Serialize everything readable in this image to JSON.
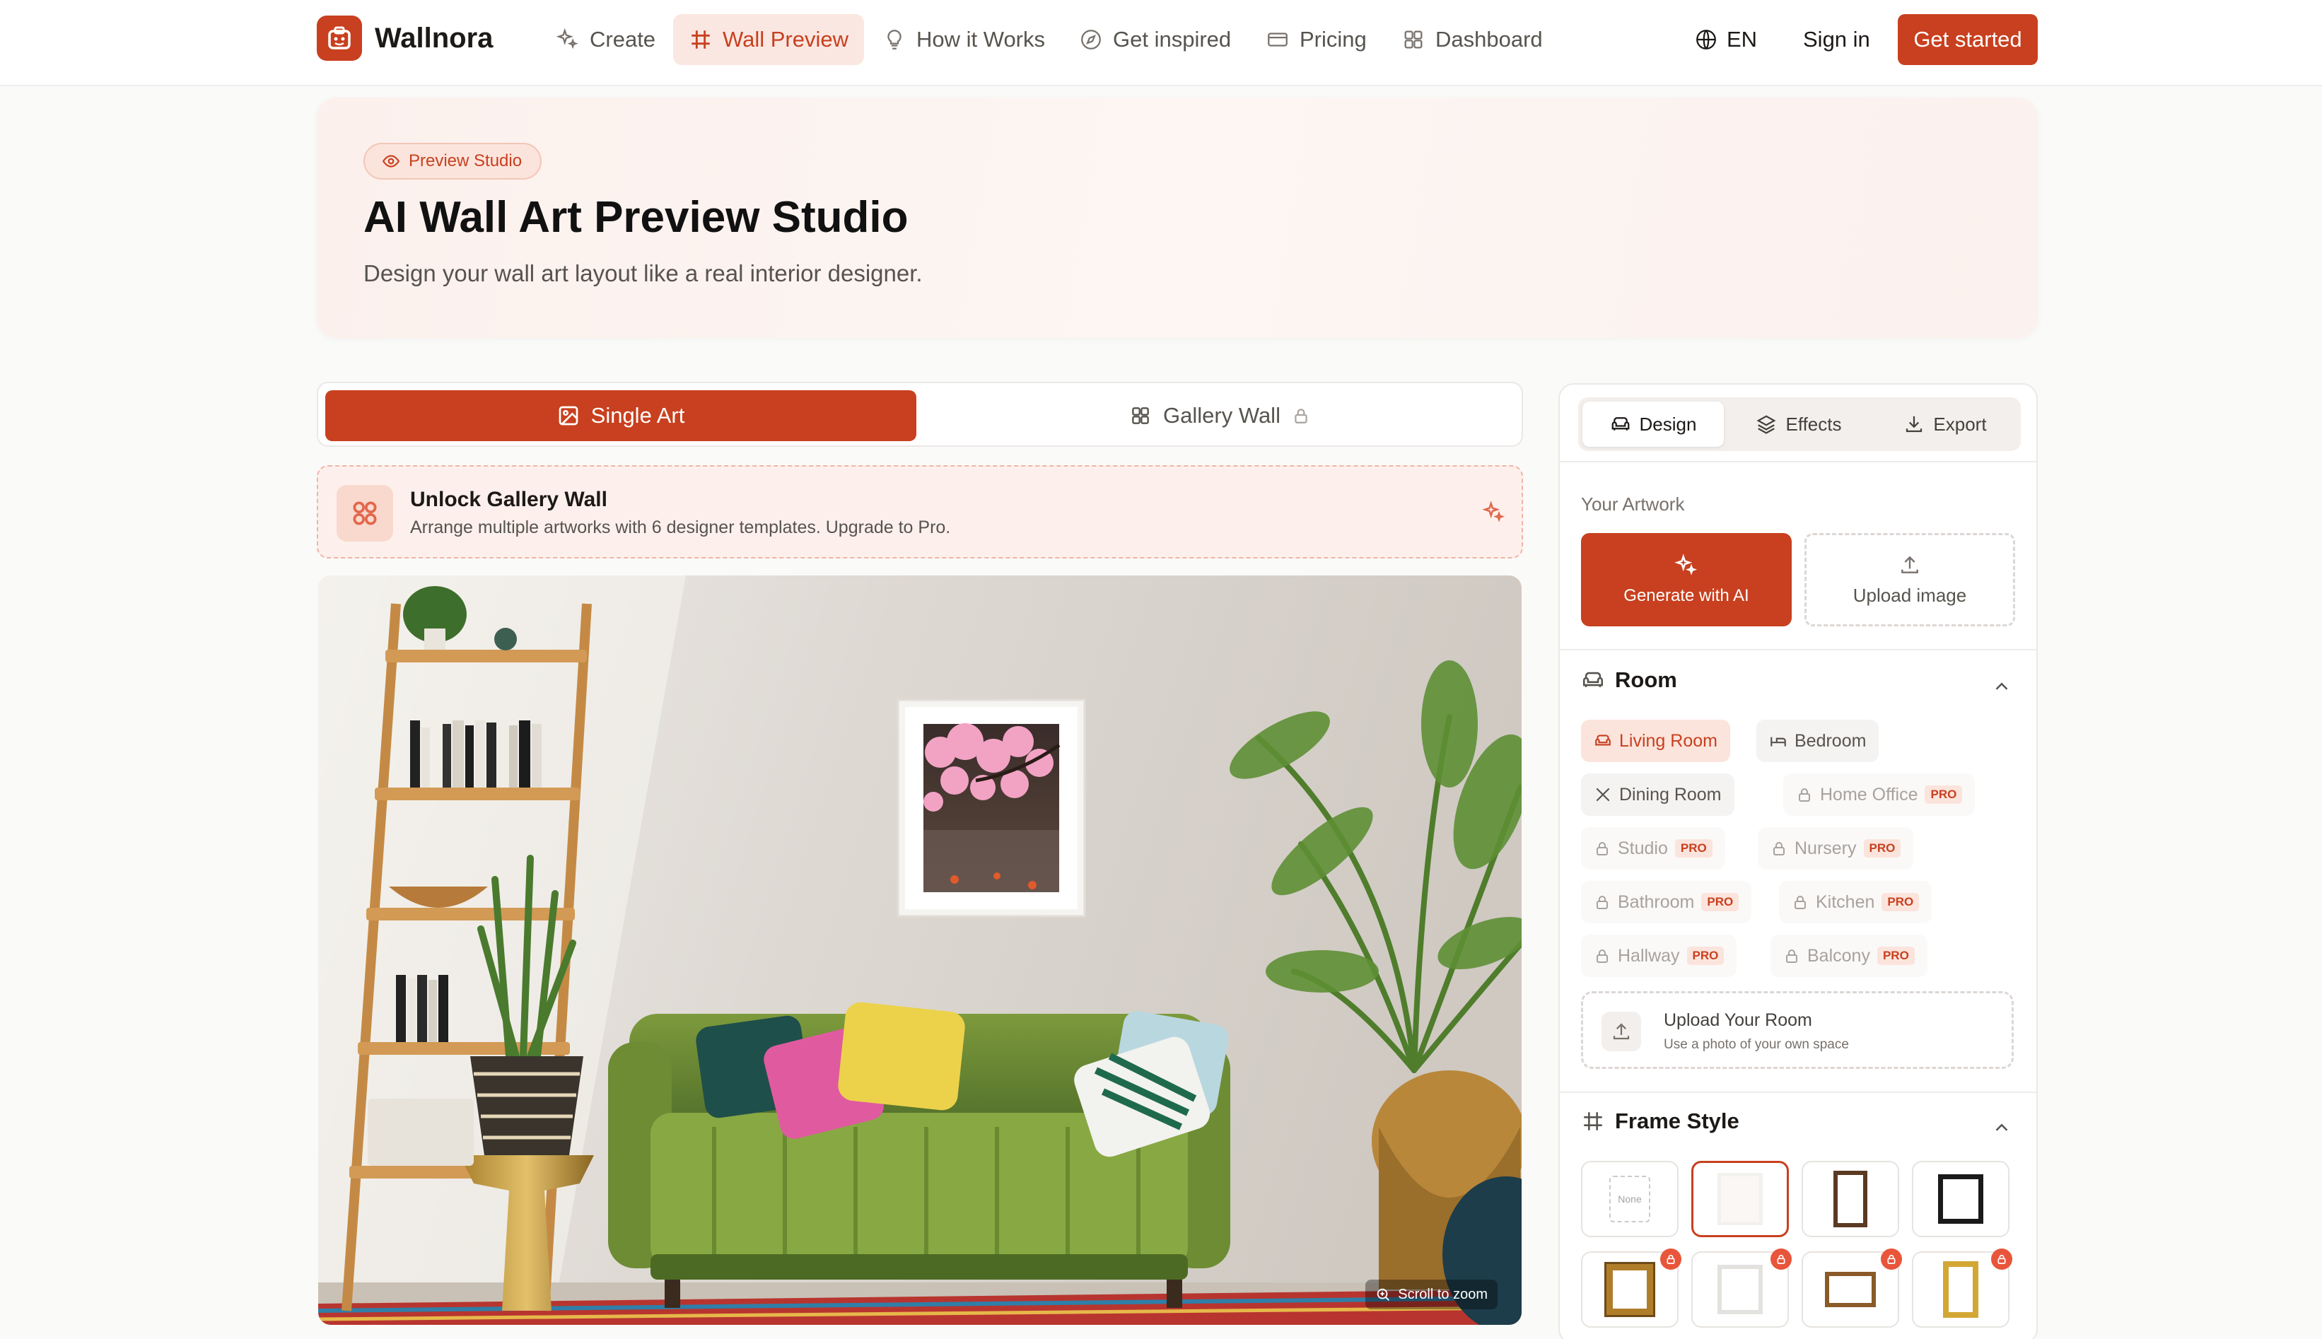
{
  "app": {
    "name": "Wallnora"
  },
  "nav": {
    "items": [
      {
        "label": "Create",
        "icon": "sparkles-icon"
      },
      {
        "label": "Wall Preview",
        "icon": "hash-frame-icon"
      },
      {
        "label": "How it Works",
        "icon": "lightbulb-icon"
      },
      {
        "label": "Get inspired",
        "icon": "compass-icon"
      },
      {
        "label": "Pricing",
        "icon": "credit-card-icon"
      },
      {
        "label": "Dashboard",
        "icon": "grid-icon"
      }
    ],
    "active": "Wall Preview",
    "language": "EN",
    "sign_in": "Sign in",
    "get_started": "Get started"
  },
  "hero": {
    "badge": "Preview Studio",
    "title": "AI Wall Art Preview Studio",
    "subtitle": "Design your wall art layout like a real interior designer."
  },
  "mode_tabs": {
    "single": "Single Art",
    "gallery": "Gallery Wall",
    "active": "Single Art"
  },
  "unlock_banner": {
    "title": "Unlock Gallery Wall",
    "description": "Arrange multiple artworks with 6 designer templates. Upgrade to Pro."
  },
  "preview": {
    "zoom_hint": "Scroll to zoom"
  },
  "panel": {
    "tabs": [
      "Design",
      "Effects",
      "Export"
    ],
    "active_tab": "Design",
    "artwork": {
      "label": "Your Artwork",
      "generate": "Generate with AI",
      "upload": "Upload image"
    },
    "room": {
      "title": "Room",
      "options": [
        {
          "label": "Living Room",
          "state": "selected",
          "pro": false
        },
        {
          "label": "Bedroom",
          "state": "free",
          "pro": false
        },
        {
          "label": "Dining Room",
          "state": "free",
          "pro": false
        },
        {
          "label": "Home Office",
          "state": "locked",
          "pro": true
        },
        {
          "label": "Studio",
          "state": "locked",
          "pro": true
        },
        {
          "label": "Nursery",
          "state": "locked",
          "pro": true
        },
        {
          "label": "Bathroom",
          "state": "locked",
          "pro": true
        },
        {
          "label": "Kitchen",
          "state": "locked",
          "pro": true
        },
        {
          "label": "Hallway",
          "state": "locked",
          "pro": true
        },
        {
          "label": "Balcony",
          "state": "locked",
          "pro": true
        }
      ],
      "pro_label": "PRO",
      "upload_title": "Upload Your Room",
      "upload_sub": "Use a photo of your own space"
    },
    "frame_style": {
      "title": "Frame Style",
      "none_label": "None",
      "options": [
        "none",
        "white",
        "walnut",
        "black",
        "gold-ornate",
        "silver",
        "wood-wide",
        "gold-baroque"
      ],
      "selected": "white"
    }
  },
  "colors": {
    "accent": "#c8401f",
    "accent_light": "#fbe4dc"
  }
}
